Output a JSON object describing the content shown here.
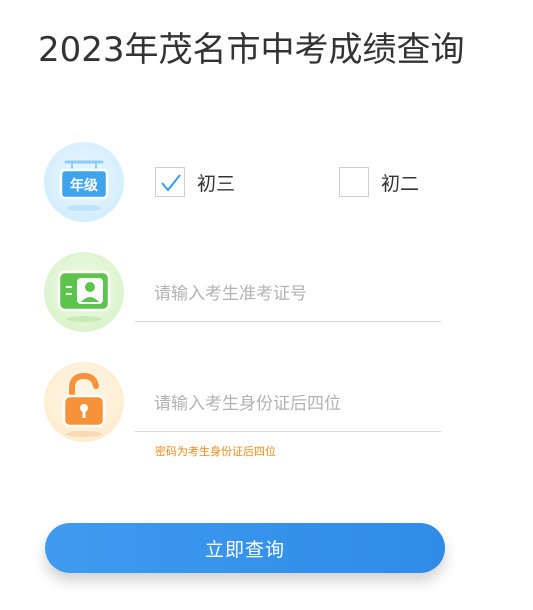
{
  "page": {
    "title": "2023年茂名市中考成绩查询"
  },
  "grade": {
    "icon_label": "年级",
    "options": [
      {
        "label": "初三",
        "checked": true
      },
      {
        "label": "初二",
        "checked": false
      }
    ]
  },
  "ticket_field": {
    "placeholder": "请输入考生准考证号",
    "value": ""
  },
  "id_field": {
    "placeholder": "请输入考生身份证后四位",
    "value": ""
  },
  "hint": {
    "text": "密码为考生身份证后四位"
  },
  "submit": {
    "label": "立即查询"
  },
  "colors": {
    "accent": "#2e8be8",
    "check": "#3a9be8",
    "hint": "#f08a1c",
    "lock": "#f6923a",
    "id_card": "#5cc44a"
  }
}
